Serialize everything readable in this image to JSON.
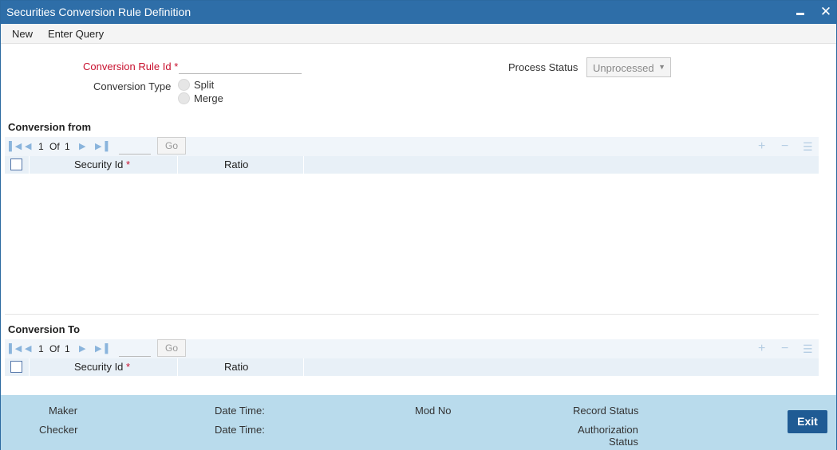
{
  "window": {
    "title": "Securities Conversion Rule Definition"
  },
  "menu": {
    "new_label": "New",
    "enter_query_label": "Enter Query"
  },
  "form": {
    "conversion_rule_id_label": "Conversion Rule Id",
    "required_mark": "*",
    "conversion_rule_id_value": "",
    "conversion_type_label": "Conversion Type",
    "conversion_type_options": [
      "Split",
      "Merge"
    ],
    "process_status_label": "Process Status",
    "process_status_value": "Unprocessed"
  },
  "conversion_from": {
    "title": "Conversion from",
    "pagination": {
      "current": "1",
      "of_label": "Of",
      "total": "1",
      "go_label": "Go"
    },
    "columns": [
      "Security Id",
      "Ratio"
    ],
    "rows": []
  },
  "conversion_to": {
    "title": "Conversion To",
    "pagination": {
      "current": "1",
      "of_label": "Of",
      "total": "1",
      "go_label": "Go"
    },
    "columns": [
      "Security Id",
      "Ratio"
    ],
    "rows": []
  },
  "footer": {
    "maker_label": "Maker",
    "checker_label": "Checker",
    "date_time_label": "Date Time:",
    "mod_no_label": "Mod No",
    "record_status_label": "Record Status",
    "authorization_label": "Authorization",
    "status_label": "Status",
    "exit_label": "Exit"
  },
  "colors": {
    "titlebar": "#2e6ea8",
    "required": "#c8102e",
    "footer": "#b9dbec",
    "exit_button": "#1f5b94"
  }
}
